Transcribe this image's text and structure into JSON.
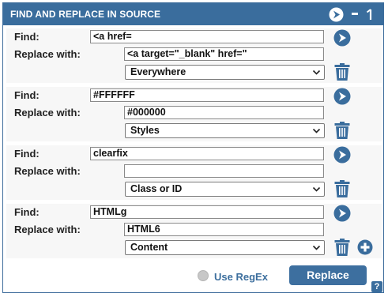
{
  "title": "FIND AND REPLACE IN SOURCE",
  "find_label": "Find:",
  "replace_label": "Replace with:",
  "rules": [
    {
      "find": "<a href=",
      "replace": "<a target=\"_blank\" href=\"",
      "scope": "Everywhere"
    },
    {
      "find": "#FFFFFF",
      "replace": "#000000",
      "scope": "Styles"
    },
    {
      "find": "clearfix",
      "replace": "",
      "scope": "Class or ID"
    },
    {
      "find": "HTMLg",
      "replace": "HTML6",
      "scope": "Content"
    }
  ],
  "use_regex_label": "Use RegEx",
  "replace_button_label": "Replace",
  "help_label": "?",
  "colors": {
    "accent": "#3a6d9d",
    "group_bg": "#f7f7f7"
  },
  "icons": [
    "run-arrow-icon",
    "minimize-icon",
    "undock-icon",
    "go-arrow-icon",
    "trash-icon",
    "add-icon",
    "chevron-down-icon"
  ]
}
